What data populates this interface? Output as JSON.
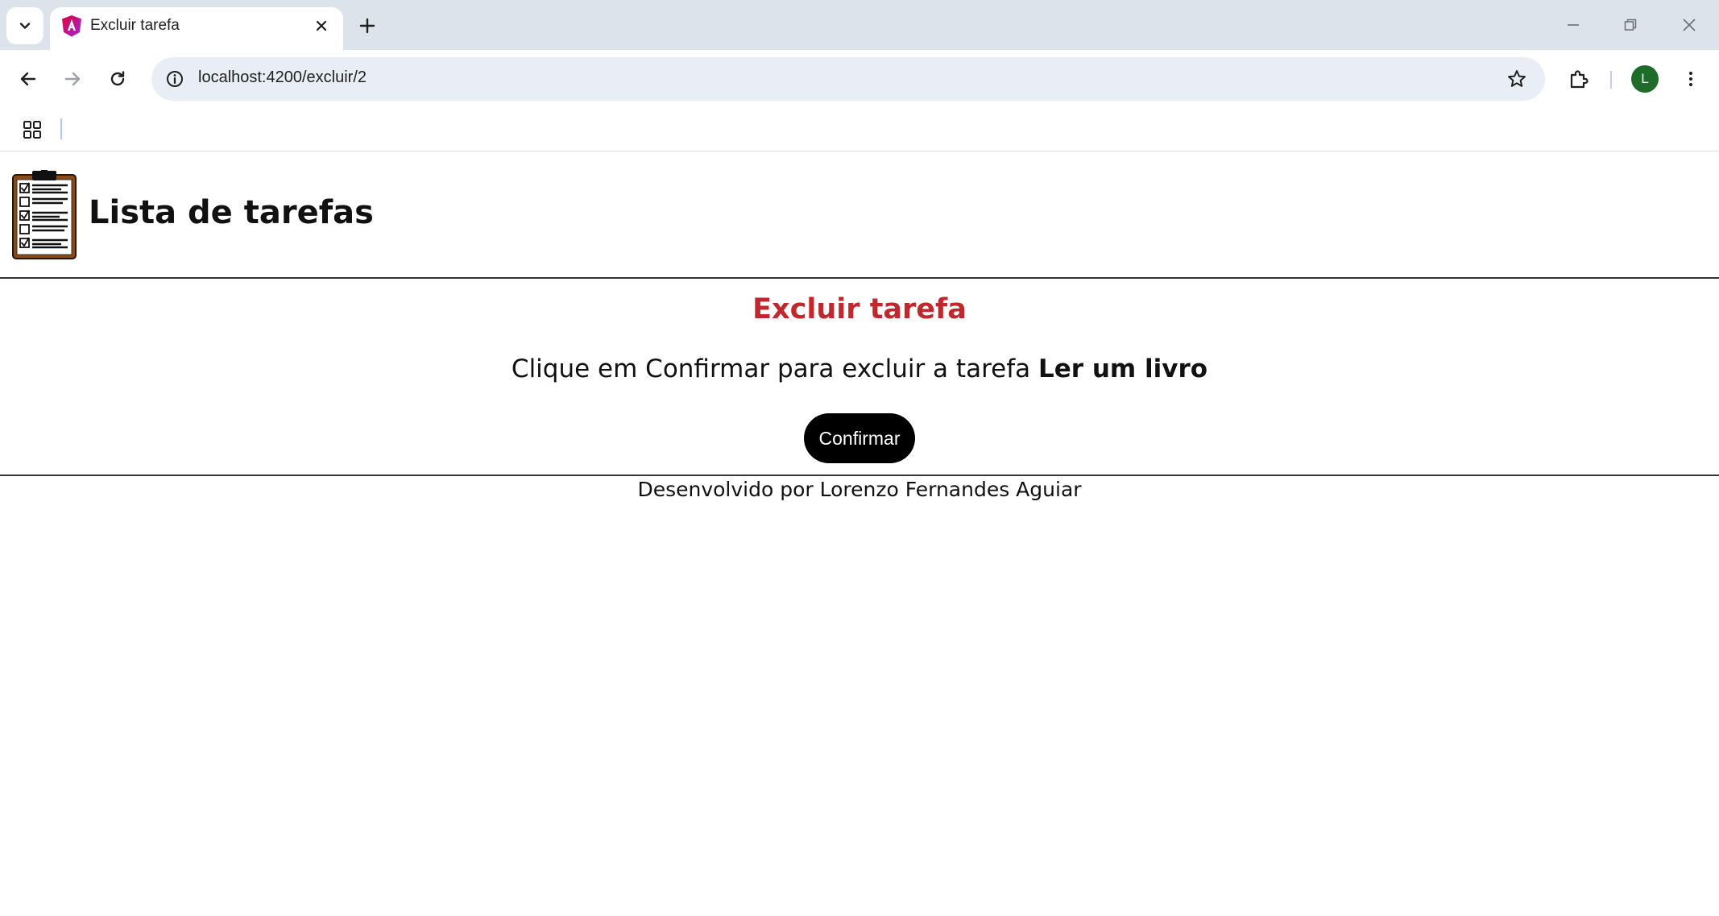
{
  "browser": {
    "tab": {
      "title": "Excluir tarefa"
    },
    "address_bar": {
      "url": "localhost:4200/excluir/2"
    },
    "profile_initial": "L",
    "colors": {
      "tabstrip": "#dde3ea",
      "omnibox": "#e9eef6",
      "avatar": "#1e6b2a"
    }
  },
  "app": {
    "title": "Lista de tarefas",
    "logo_icon": "clipboard-checklist-icon"
  },
  "delete_page": {
    "heading": "Excluir tarefa",
    "message_prefix": "Clique em Confirmar para excluir a tarefa",
    "task_name": "Ler um livro",
    "confirm_label": "Confirmar",
    "heading_color": "#c0282e"
  },
  "footer": {
    "text": "Desenvolvido por Lorenzo Fernandes Aguiar"
  }
}
